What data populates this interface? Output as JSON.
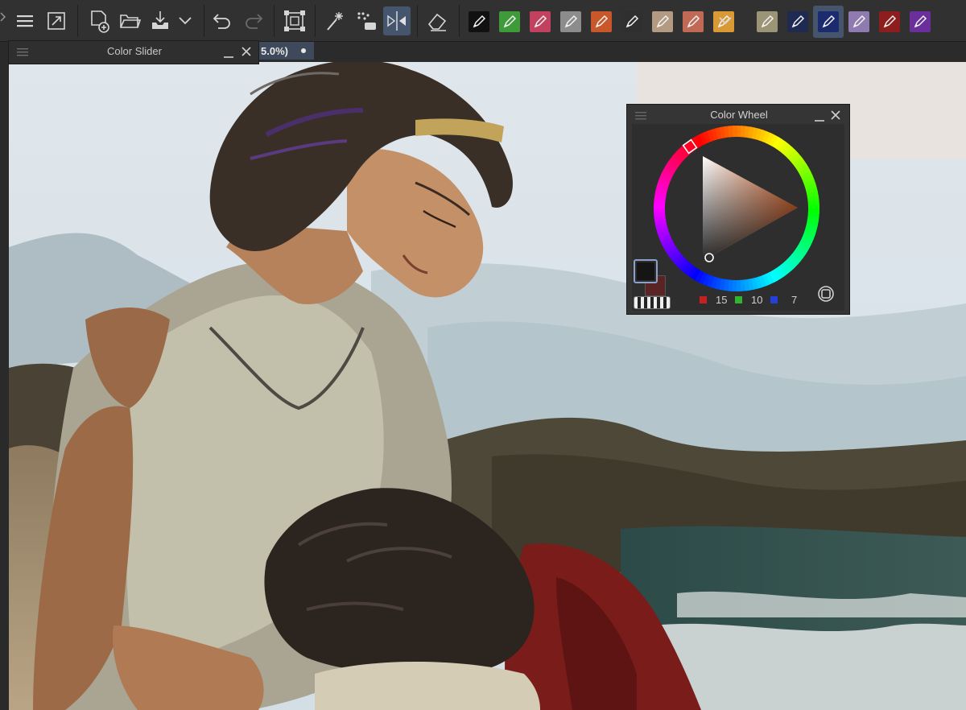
{
  "toolbar": {
    "tools": [
      {
        "name": "menu-icon"
      },
      {
        "name": "fullscreen-icon"
      },
      {
        "name": "new-document-icon"
      },
      {
        "name": "open-folder-icon"
      },
      {
        "name": "save-icon"
      },
      {
        "name": "dropdown-icon"
      },
      {
        "name": "undo-icon"
      },
      {
        "name": "redo-icon"
      },
      {
        "name": "wrap-around-icon"
      },
      {
        "name": "magic-wand-icon"
      },
      {
        "name": "brush-dot-icon"
      },
      {
        "name": "mirror-icon",
        "active": true
      },
      {
        "name": "eraser-icon"
      }
    ],
    "brush_presets": [
      {
        "name": "ink-pen-preset",
        "color": "#111111"
      },
      {
        "name": "green-pen-preset",
        "color": "#3f9a3a"
      },
      {
        "name": "pink-pen-preset",
        "color": "#c2415e"
      },
      {
        "name": "grey-pen-preset",
        "color": "#8c8c8c"
      },
      {
        "name": "orange-brush-preset",
        "color": "#c8582a"
      },
      {
        "name": "lasso-preset",
        "color": "#2f2f2f"
      },
      {
        "name": "blender-preset",
        "color": "#b39a83"
      },
      {
        "name": "smudge-preset",
        "color": "#c06a55"
      },
      {
        "name": "yellow-brush-preset",
        "color": "#d99a36"
      },
      {
        "name": "texture-preset",
        "color": "#9c9477"
      },
      {
        "name": "shield-preset",
        "color": "#1e2a52"
      },
      {
        "name": "blue-pen-preset",
        "color": "#1b2b6e",
        "active": true
      },
      {
        "name": "lavender-pen-preset",
        "color": "#8f7bb0"
      },
      {
        "name": "red-eraser-preset",
        "color": "#8e1d1d"
      },
      {
        "name": "purple-pen-preset",
        "color": "#6a2f9a"
      }
    ]
  },
  "document_tab": {
    "label": "5.0%)"
  },
  "color_slider": {
    "title": "Color Slider"
  },
  "color_wheel": {
    "title": "Color Wheel",
    "foreground": "#151515",
    "background": "#5a2424",
    "red": "15",
    "green": "10",
    "blue": "7",
    "hue_color": "#e0692e"
  }
}
